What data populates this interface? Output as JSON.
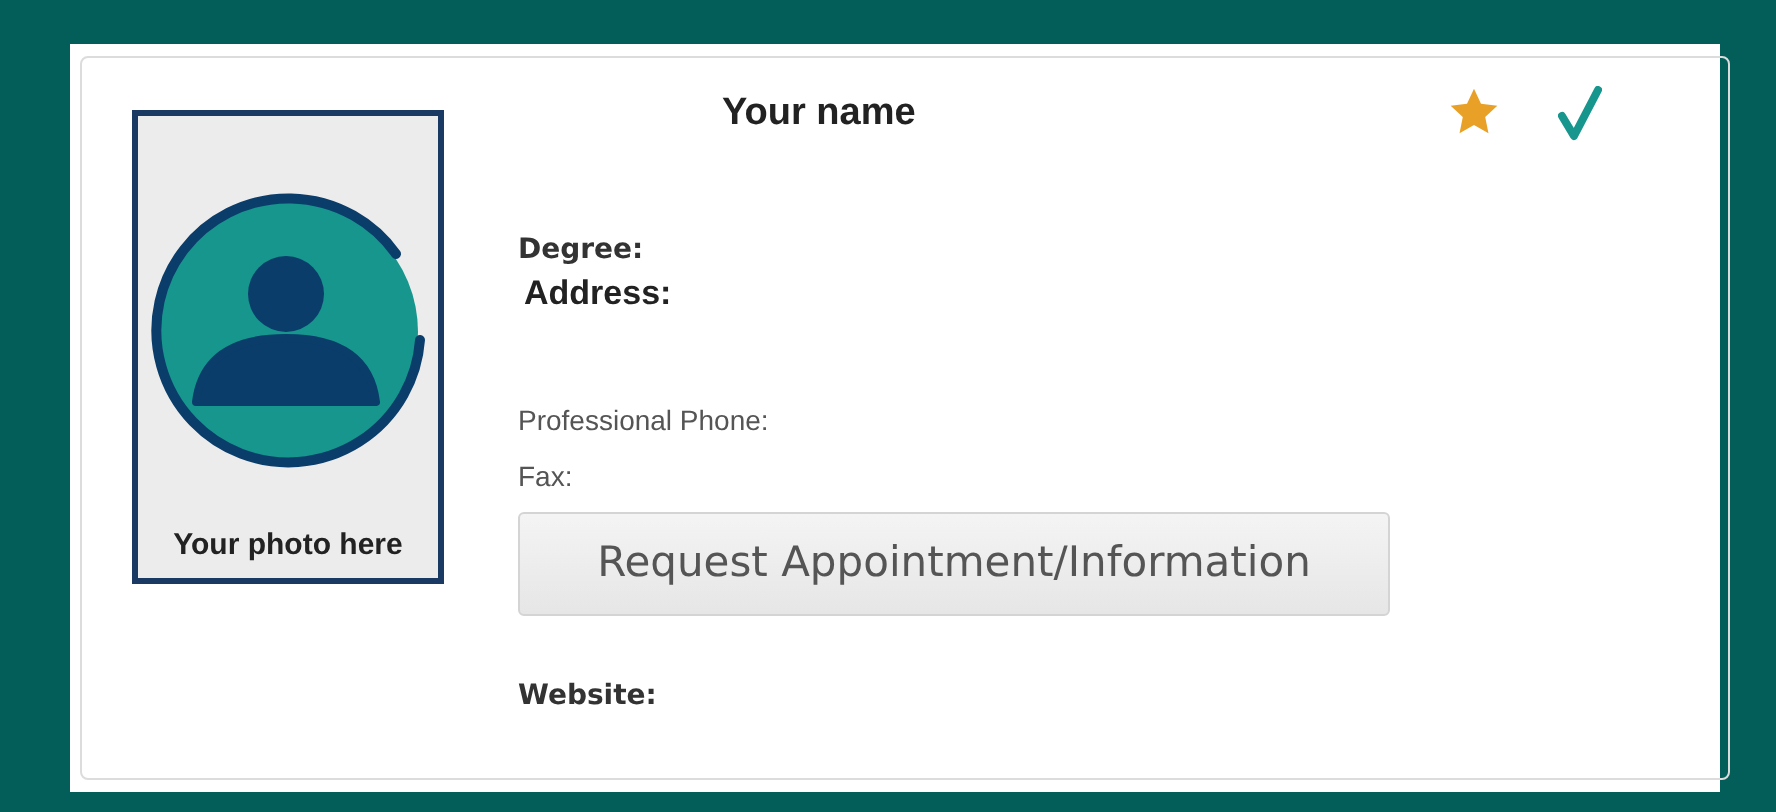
{
  "profile": {
    "name": "Your name",
    "photo_caption": "Your photo here"
  },
  "fields": [
    {
      "kind": "strong",
      "label": "Degree:"
    },
    {
      "kind": "heading",
      "label": "Address:"
    },
    {
      "kind": "plain",
      "label": "Professional Phone:"
    },
    {
      "kind": "plain",
      "label": "Fax:"
    }
  ],
  "button": {
    "label": "Request Appointment/Information"
  },
  "website": {
    "label": "Website:"
  }
}
